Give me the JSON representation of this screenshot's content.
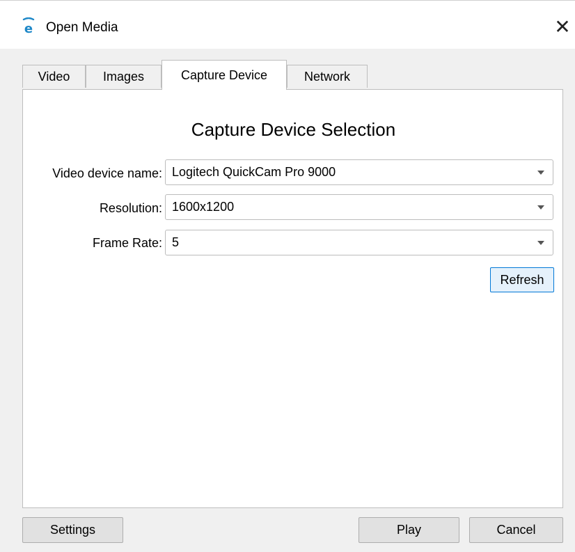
{
  "window": {
    "title": "Open Media",
    "icon": "app-logo-icon",
    "close_glyph": "✕"
  },
  "tabs": [
    {
      "label": "Video",
      "active": false
    },
    {
      "label": "Images",
      "active": false
    },
    {
      "label": "Capture Device",
      "active": true
    },
    {
      "label": "Network",
      "active": false
    }
  ],
  "capture": {
    "heading": "Capture Device Selection",
    "video_device_label": "Video device name:",
    "video_device_value": "Logitech QuickCam Pro 9000",
    "resolution_label": "Resolution:",
    "resolution_value": "1600x1200",
    "frame_rate_label": "Frame Rate:",
    "frame_rate_value": "5",
    "refresh_label": "Refresh"
  },
  "footer": {
    "settings_label": "Settings",
    "play_label": "Play",
    "cancel_label": "Cancel"
  },
  "colors": {
    "accent": "#0078d7",
    "app_icon": "#1e88c8"
  }
}
